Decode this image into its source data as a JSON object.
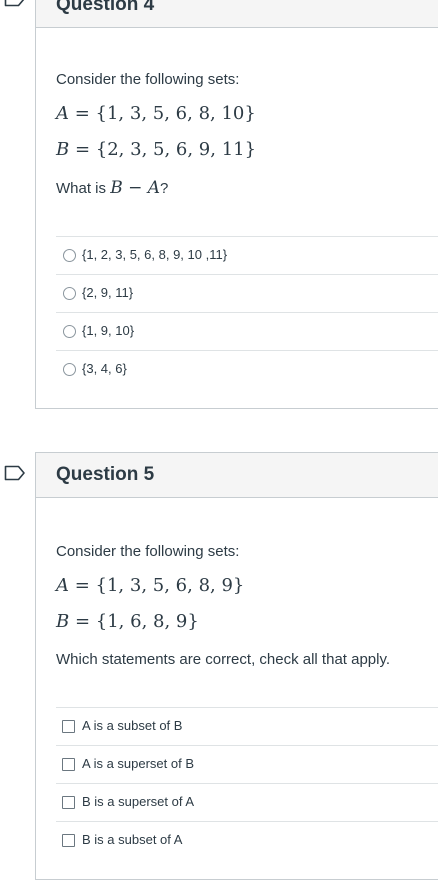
{
  "q4": {
    "title": "Question 4",
    "intro": "Consider the following sets:",
    "set_a": {
      "name": "A",
      "elements": "{1,  3,  5,  6,  8,  10}"
    },
    "set_b": {
      "name": "B",
      "elements": "{2,  3,  5,  6,  9,  11}"
    },
    "prompt_prefix": "What is ",
    "prompt_expr_left": "B",
    "prompt_expr_right": "A",
    "prompt_suffix": "?",
    "options": [
      "{1, 2, 3, 5, 6, 8, 9, 10 ,11}",
      "{2, 9, 11}",
      "{1, 9, 10}",
      "{3, 4, 6}"
    ]
  },
  "q5": {
    "title": "Question 5",
    "intro": "Consider the following sets:",
    "set_a": {
      "name": "A",
      "elements": "{1, 3, 5, 6, 8, 9}"
    },
    "set_b": {
      "name": "B",
      "elements": "{1, 6, 8, 9}"
    },
    "prompt": "Which statements are correct, check all that apply.",
    "options": [
      "A is a subset of B",
      "A is a superset of B",
      "B is a superset of A",
      "B is a subset of A"
    ]
  },
  "icons": {
    "flag": "bookmark-flag-icon"
  },
  "colors": {
    "text": "#2d3b45",
    "border": "#c7cdd1",
    "header_bg": "#f5f5f5"
  }
}
